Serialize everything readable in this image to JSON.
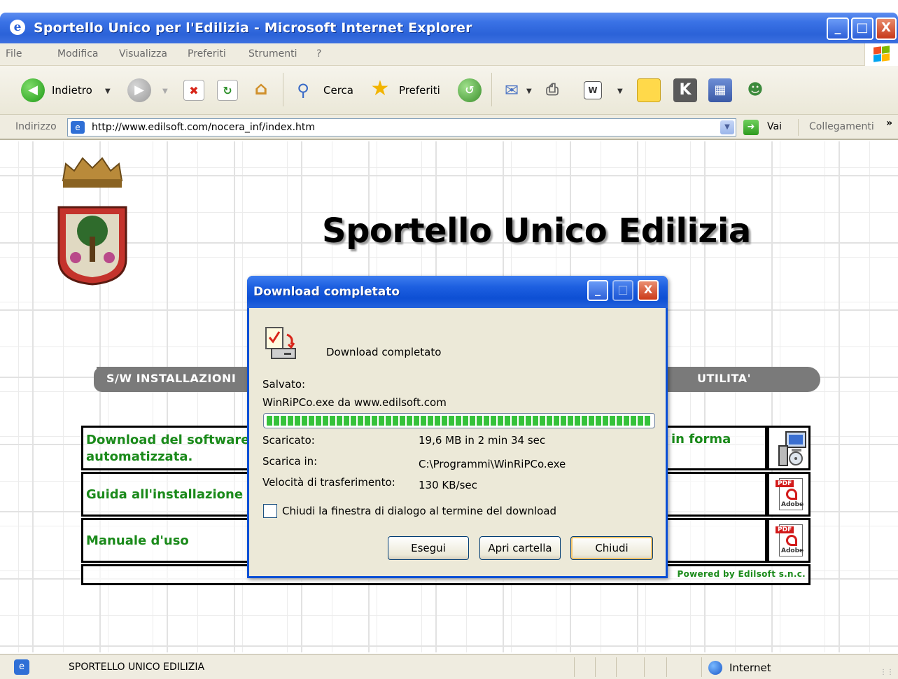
{
  "window": {
    "title": "Sportello Unico per l'Edilizia - Microsoft Internet Explorer",
    "minimize": "_",
    "maximize": "□",
    "close": "X"
  },
  "menu": {
    "items": [
      "File",
      "Modifica",
      "Visualizza",
      "Preferiti",
      "Strumenti",
      "?"
    ]
  },
  "toolbar": {
    "back_label": "Indietro",
    "search_label": "Cerca",
    "favorites_label": "Preferiti"
  },
  "address": {
    "label": "Indirizzo",
    "url": "http://www.edilsoft.com/nocera_inf/index.htm",
    "go_label": "Vai",
    "links_label": "Collegamenti",
    "more": "»"
  },
  "page": {
    "heading": "Sportello Unico Edilizia",
    "section_left": "S/W INSTALLAZIONI",
    "section_right": "UTILITA'",
    "rows": [
      {
        "text": "Download del software",
        "text2": "automatizzata.",
        "right": "in forma"
      },
      {
        "text": "Guida all'installazione e",
        "text2": "",
        "right": ""
      },
      {
        "text": "Manuale d'uso",
        "text2": "",
        "right": ""
      }
    ],
    "pdf_tag": "PDF",
    "adobe": "Adobe",
    "powered": "Powered by Edilsoft s.n.c."
  },
  "dialog": {
    "title": "Download completato",
    "headline": "Download completato",
    "saved_label": "Salvato:",
    "saved_value": "WinRiPCo.exe da www.edilsoft.com",
    "progress": 1.0,
    "downloaded_label": "Scaricato:",
    "downloaded_value": "19,6 MB in 2 min 34 sec",
    "target_label": "Scarica in:",
    "target_value": "C:\\Programmi\\WinRiPCo.exe",
    "speed_label": "Velocità di trasferimento:",
    "speed_value": "130 KB/sec",
    "checkbox_label": "Chiudi la finestra di dialogo al termine del download",
    "checkbox_checked": false,
    "run_button": "Esegui",
    "open_folder_button": "Apri cartella",
    "close_button": "Chiudi"
  },
  "status": {
    "text": "SPORTELLO UNICO EDILIZIA",
    "zone": "Internet"
  },
  "colors": {
    "xp_blue": "#2b62d8",
    "link_green": "#1a8a1a",
    "progress_green": "#35c23a",
    "section_gray": "#7a7a7a"
  }
}
